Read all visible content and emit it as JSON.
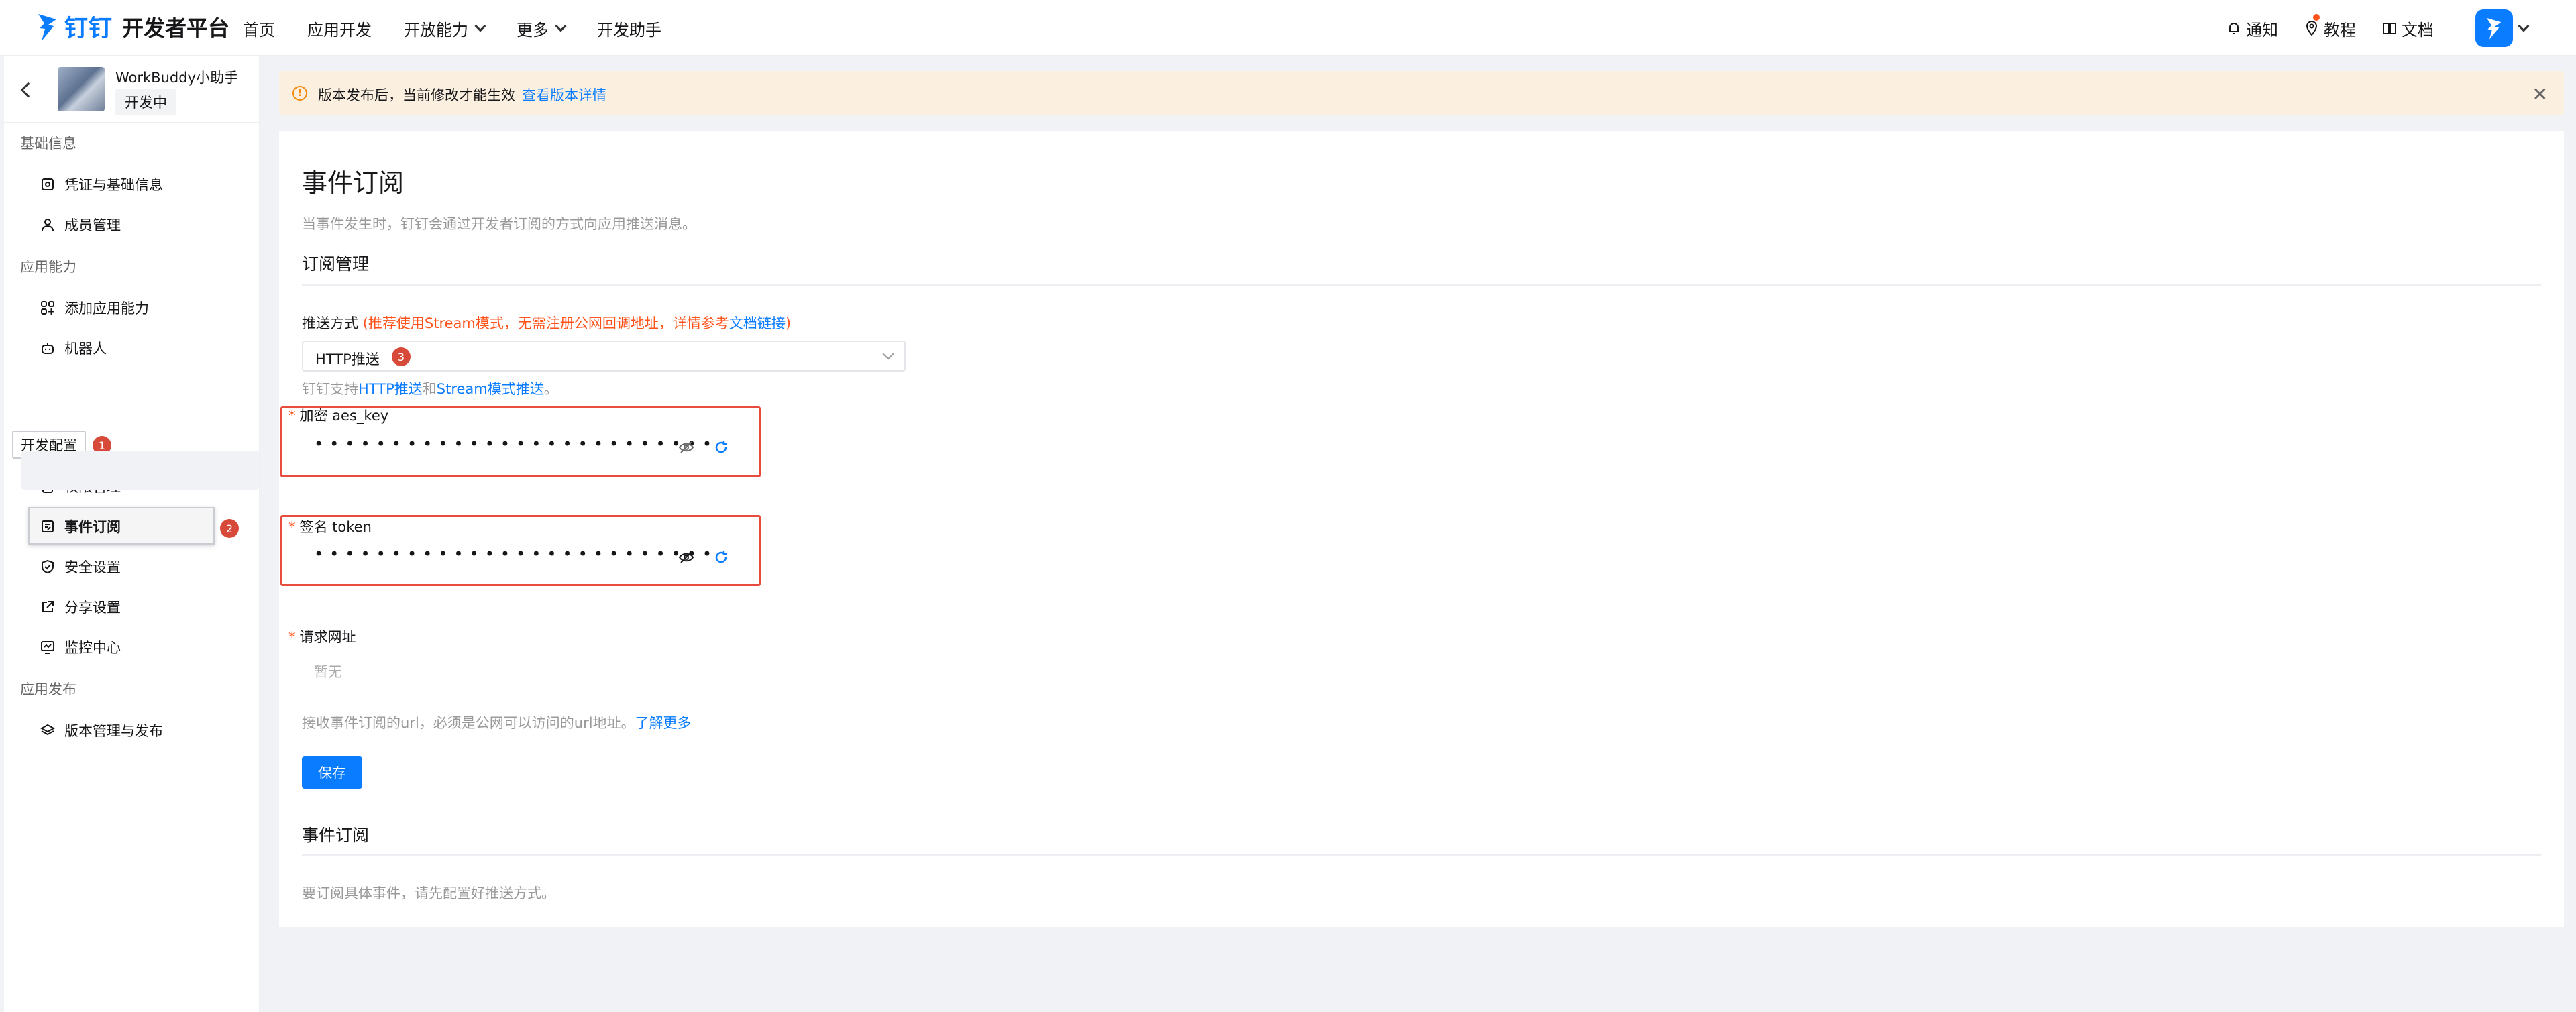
{
  "header": {
    "brand": "钉钉",
    "title": "开发者平台",
    "nav": [
      {
        "label": "首页"
      },
      {
        "label": "应用开发"
      },
      {
        "label": "开放能力",
        "dropdown": true
      },
      {
        "label": "更多",
        "dropdown": true
      },
      {
        "label": "开发助手"
      }
    ],
    "right": [
      {
        "label": "通知",
        "icon": "bell-icon"
      },
      {
        "label": "教程",
        "icon": "location-pin-icon"
      },
      {
        "label": "文档",
        "icon": "book-icon"
      }
    ]
  },
  "app": {
    "name": "WorkBuddy小助手",
    "status": "开发中"
  },
  "sidebar": {
    "sections": [
      {
        "title": "基础信息",
        "items": [
          {
            "label": "凭证与基础信息",
            "icon": "credential-icon"
          },
          {
            "label": "成员管理",
            "icon": "user-icon"
          }
        ]
      },
      {
        "title": "应用能力",
        "items": [
          {
            "label": "添加应用能力",
            "icon": "grid-plus-icon"
          },
          {
            "label": "机器人",
            "icon": "robot-icon"
          }
        ]
      },
      {
        "title": "开发配置",
        "items": [
          {
            "label": "权限管理",
            "icon": "lock-icon"
          },
          {
            "label": "事件订阅",
            "icon": "event-icon",
            "active": true
          },
          {
            "label": "安全设置",
            "icon": "shield-icon"
          },
          {
            "label": "分享设置",
            "icon": "share-icon"
          },
          {
            "label": "监控中心",
            "icon": "monitor-icon"
          }
        ]
      },
      {
        "title": "应用发布",
        "items": [
          {
            "label": "版本管理与发布",
            "icon": "layers-icon"
          }
        ]
      }
    ]
  },
  "annotations": {
    "badge1": "1",
    "badge2": "2",
    "badge3": "3"
  },
  "banner": {
    "text": "版本发布后，当前修改才能生效",
    "link": "查看版本详情"
  },
  "main": {
    "title": "事件订阅",
    "description": "当事件发生时，钉钉会通过开发者订阅的方式向应用推送消息。",
    "subscription_title": "订阅管理",
    "push_label": "推送方式",
    "push_hint_prefix": "(推荐使用Stream模式，无需注册公网回调地址，详情参考",
    "push_hint_link": "文档链接",
    "push_hint_suffix": ")",
    "push_value": "HTTP推送",
    "support_prefix": "钉钉支持",
    "support_link1": "HTTP推送",
    "support_and": "和",
    "support_link2": "Stream模式推送",
    "support_suffix": "。",
    "aes_label": "加密 aes_key",
    "aes_value": "••••••••••••••••••••••••••",
    "token_label": "签名 token",
    "token_value": "••••••••••••••••••••••••••",
    "url_label": "请求网址",
    "url_placeholder": "暂无",
    "url_hint": "接收事件订阅的url，必须是公网可以访问的url地址。",
    "url_hint_link": "了解更多",
    "save_label": "保存",
    "events_title": "事件订阅",
    "events_hint": "要订阅具体事件，请先配置好推送方式。"
  },
  "colors": {
    "accent": "#0a7cff",
    "warning_bg": "#fbefe0",
    "warning_icon": "#f28a0e",
    "error": "#ff5219",
    "highlight_border": "#e74c3c",
    "badge": "#d74a3a"
  }
}
